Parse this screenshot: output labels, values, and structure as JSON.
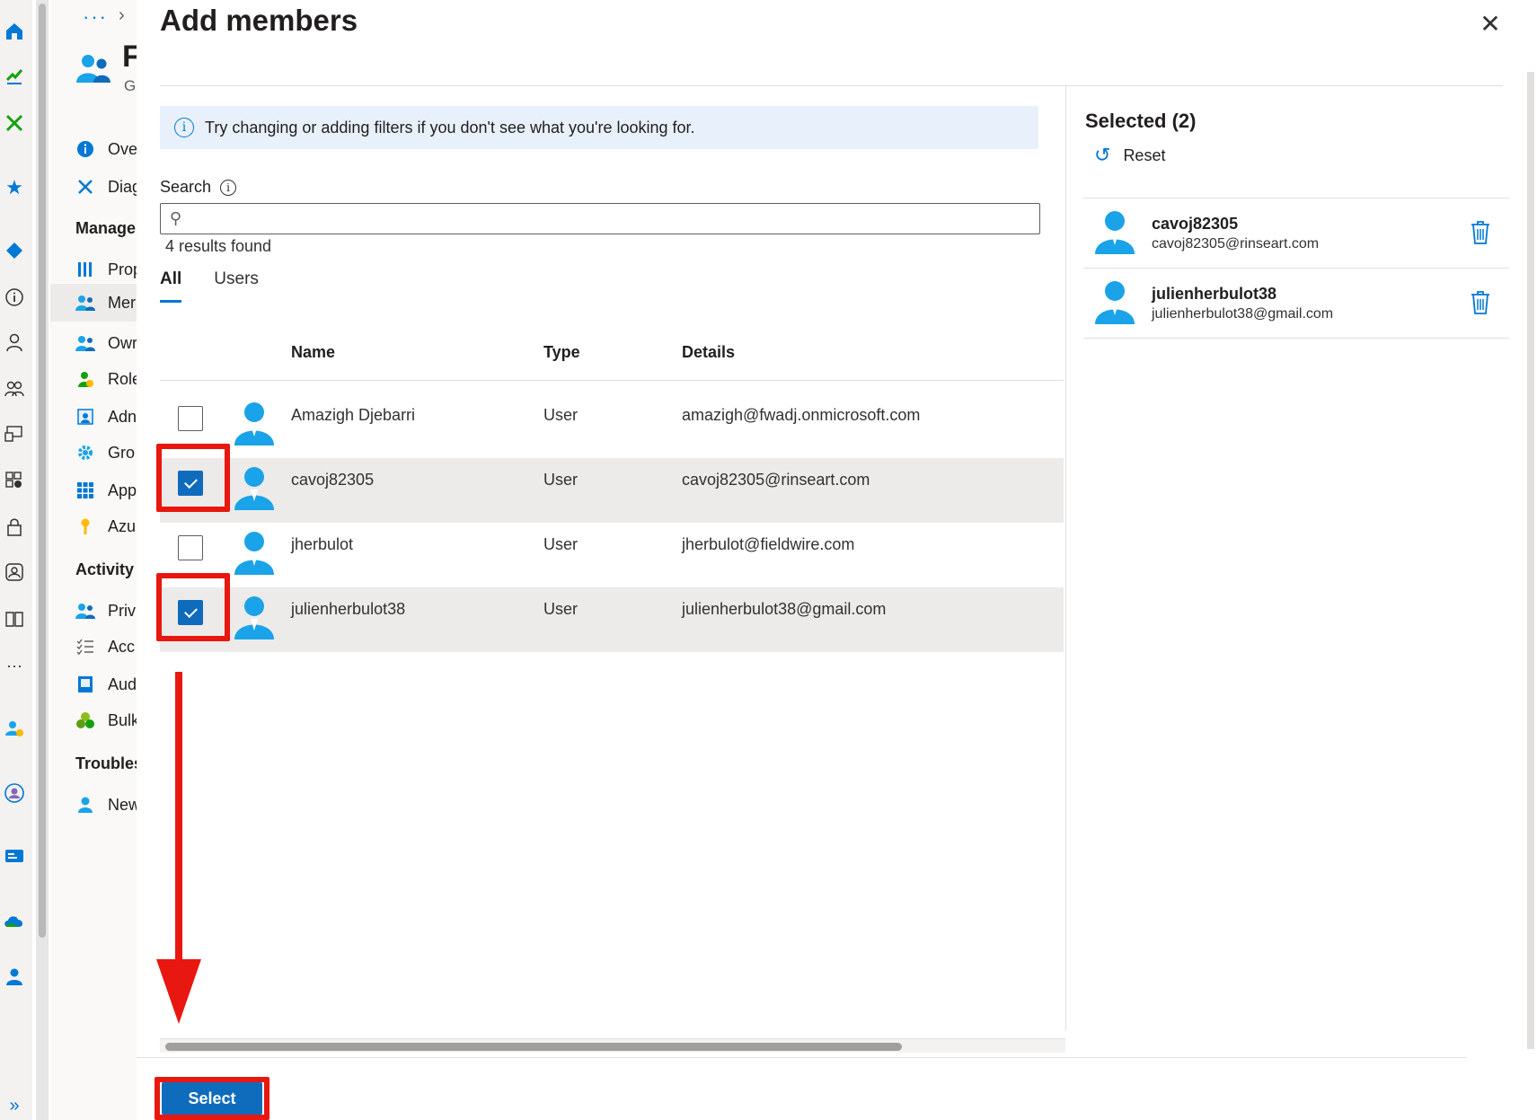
{
  "rail": {
    "icons": [
      "home-icon",
      "dashboard-icon",
      "tools-icon",
      "star-icon",
      "diamond-icon",
      "info-icon",
      "user-icon",
      "users-icon",
      "devices-icon",
      "apps-icon",
      "lock-icon",
      "identity-icon",
      "book-icon",
      "more-icon",
      "user-settings-icon",
      "user-circle-icon",
      "id-card-icon",
      "cloud-icon",
      "admin-icon",
      "expand-icon"
    ],
    "more_glyph": "···",
    "expand_glyph": "»"
  },
  "nav": {
    "breadcrumb_ellipsis": "···",
    "breadcrumb_chevron": "›",
    "title_initial": "F",
    "subtitle_initial": "G",
    "items": [
      {
        "label": "Ove",
        "icon": "info-icon"
      },
      {
        "label": "Diag",
        "icon": "diagnose-icon"
      }
    ],
    "manage_section": "Manage",
    "manage_items": [
      {
        "label": "Prop",
        "icon": "properties-icon"
      },
      {
        "label": "Mer",
        "icon": "members-icon"
      },
      {
        "label": "Owr",
        "icon": "owners-icon"
      },
      {
        "label": "Role",
        "icon": "roles-icon"
      },
      {
        "label": "Adn",
        "icon": "admin-units-icon"
      },
      {
        "label": "Gro",
        "icon": "group-settings-icon"
      },
      {
        "label": "App",
        "icon": "applications-icon"
      },
      {
        "label": "Azu",
        "icon": "key-icon"
      }
    ],
    "activity_section": "Activity",
    "activity_items": [
      {
        "label": "Priv",
        "icon": "privileged-icon"
      },
      {
        "label": "Acc",
        "icon": "access-reviews-icon"
      },
      {
        "label": "Aud",
        "icon": "audit-icon"
      },
      {
        "label": "Bulk",
        "icon": "bulk-icon"
      }
    ],
    "trouble_section": "Troubles",
    "trouble_items": [
      {
        "label": "New",
        "icon": "new-support-icon"
      }
    ]
  },
  "panel": {
    "title": "Add members",
    "close_glyph": "✕",
    "info_glyph": "i",
    "info_text": "Try changing or adding filters if you don't see what you're looking for.",
    "search_label": "Search",
    "search_value": "",
    "search_placeholder": "",
    "search_glyph": "⚲",
    "results_text": "4 results found",
    "tabs": [
      "All",
      "Users"
    ],
    "active_tab": "All",
    "columns": {
      "name": "Name",
      "type": "Type",
      "details": "Details"
    },
    "rows": [
      {
        "name": "Amazigh Djebarri",
        "type": "User",
        "details": "amazigh@fwadj.onmicrosoft.com",
        "checked": false
      },
      {
        "name": "cavoj82305",
        "type": "User",
        "details": "cavoj82305@rinseart.com",
        "checked": true
      },
      {
        "name": "jherbulot",
        "type": "User",
        "details": "jherbulot@fieldwire.com",
        "checked": false
      },
      {
        "name": "julienherbulot38",
        "type": "User",
        "details": "julienherbulot38@gmail.com",
        "checked": true
      }
    ],
    "select_label": "Select"
  },
  "selected": {
    "title": "Selected (2)",
    "reset_label": "Reset",
    "reset_glyph": "↺",
    "items": [
      {
        "name": "cavoj82305",
        "email": "cavoj82305@rinseart.com"
      },
      {
        "name": "julienherbulot38",
        "email": "julienherbulot38@gmail.com"
      }
    ]
  },
  "colors": {
    "accent": "#0f6cbd",
    "highlight": "#e8170f",
    "avatar": "#1aa3e8",
    "info_bg": "#e8f1fb",
    "row_selected_bg": "#edebe9"
  }
}
